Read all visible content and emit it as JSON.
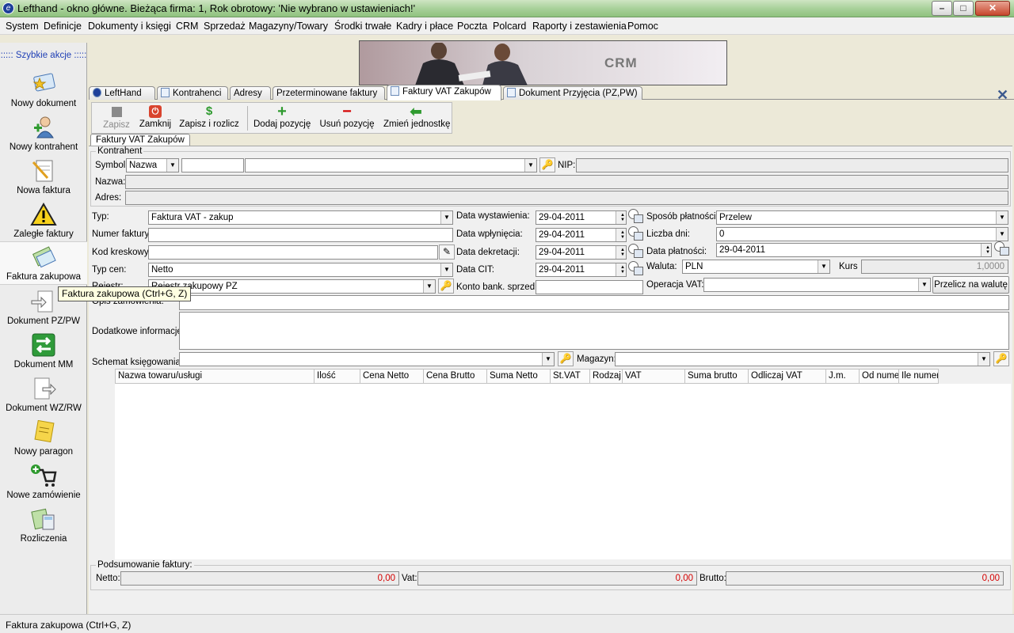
{
  "window": {
    "title": "Lefthand - okno główne. Bieżąca firma: 1, Rok obrotowy: 'Nie wybrano w ustawieniach!'",
    "controls": [
      "–",
      "□",
      "✕"
    ]
  },
  "menu": [
    "System",
    "Definicje",
    "Dokumenty i księgi",
    "CRM",
    "Sprzedaż",
    "Magazyny/Towary",
    "Środki trwałe",
    "Kadry i płace",
    "Poczta",
    "Polcard",
    "Raporty i zestawienia",
    "Pomoc"
  ],
  "sidebar": {
    "title": "::::: Szybkie akcje :::::",
    "items": [
      {
        "label": "Nowy dokument",
        "icon": "document-star-icon"
      },
      {
        "label": "Nowy kontrahent",
        "icon": "add-person-icon"
      },
      {
        "label": "Nowa faktura",
        "icon": "invoice-pencil-icon"
      },
      {
        "label": "Zaległe faktury",
        "icon": "warning-icon"
      },
      {
        "label": "Faktura zakupowa",
        "icon": "purchase-invoice-icon"
      },
      {
        "label": "Dokument PZ/PW",
        "icon": "document-in-icon"
      },
      {
        "label": "Dokument MM",
        "icon": "transfer-arrows-icon"
      },
      {
        "label": "Dokument WZ/RW",
        "icon": "document-out-icon"
      },
      {
        "label": "Nowy paragon",
        "icon": "receipt-icon"
      },
      {
        "label": "Nowe zamówienie",
        "icon": "cart-add-icon"
      },
      {
        "label": "Rozliczenia",
        "icon": "calculator-icon"
      }
    ]
  },
  "banner": {
    "text": "CRM"
  },
  "tabs": [
    "LeftHand",
    "Kontrahenci",
    "Adresy",
    "Przeterminowane faktury",
    "Faktury VAT Zakupów",
    "Dokument Przyjęcia (PZ,PW)"
  ],
  "active_tab": "Faktury VAT Zakupów",
  "toolbar": {
    "save": "Zapisz",
    "close": "Zamknij",
    "save_settle": "Zapisz i rozlicz",
    "add_line": "Dodaj pozycję",
    "remove_line": "Usuń pozycję",
    "change_unit": "Zmień jednostkę"
  },
  "subtab": "Faktury VAT Zakupów",
  "contractor": {
    "group_label": "Kontrahent",
    "symbol_label": "Symbol:",
    "symbol_mode": "Nazwa",
    "symbol_value": "",
    "nip_label": "NIP:",
    "name_label": "Nazwa:",
    "address_label": "Adres:"
  },
  "form": {
    "type_label": "Typ:",
    "type_value": "Faktura VAT - zakup",
    "invoice_no_label": "Numer faktury:",
    "barcode_label": "Kod kreskowy:",
    "price_type_label": "Typ cen:",
    "price_type_value": "Netto",
    "register_label": "Rejestr:",
    "register_value": "Rejestr zakupowy PZ",
    "order_desc_label": "Opis zamówienia:",
    "extra_info_label": "Dodatkowe informacje:",
    "schema_label": "Schemat księgowania:",
    "warehouse_label": "Magazyn:",
    "issue_date_label": "Data wystawienia:",
    "issue_date": "29-04-2011",
    "receipt_date_label": "Data wpłynięcia:",
    "receipt_date": "29-04-2011",
    "decree_date_label": "Data dekretacji:",
    "decree_date": "29-04-2011",
    "cit_date_label": "Data CIT:",
    "cit_date": "29-04-2011",
    "bank_account_label": "Konto bank. sprzed.:",
    "payment_method_label": "Sposób płatności:",
    "payment_method": "Przelew",
    "days_label": "Liczba dni:",
    "days_value": "0",
    "payment_date_label": "Data płatności:",
    "payment_date": "29-04-2011",
    "currency_label": "Waluta:",
    "currency_value": "PLN",
    "rate_label": "Kurs",
    "rate_value": "1,0000",
    "vat_operation_label": "Operacja VAT:",
    "convert_button": "Przelicz na walutę"
  },
  "grid": {
    "columns": [
      "Nazwa towaru/usługi",
      "Ilość",
      "Cena Netto",
      "Cena Brutto",
      "Suma Netto",
      "St.VAT",
      "Rodzaj",
      "VAT",
      "Suma brutto",
      "Odliczaj VAT",
      "J.m.",
      "Od nume",
      "Ile numer"
    ]
  },
  "summary": {
    "group_label": "Podsumowanie faktury:",
    "net_label": "Netto:",
    "net_value": "0,00",
    "vat_label": "Vat:",
    "vat_value": "0,00",
    "gross_label": "Brutto:",
    "gross_value": "0,00"
  },
  "tooltip": "Faktura zakupowa (Ctrl+G, Z)",
  "status_text": "Faktura zakupowa (Ctrl+G, Z)"
}
